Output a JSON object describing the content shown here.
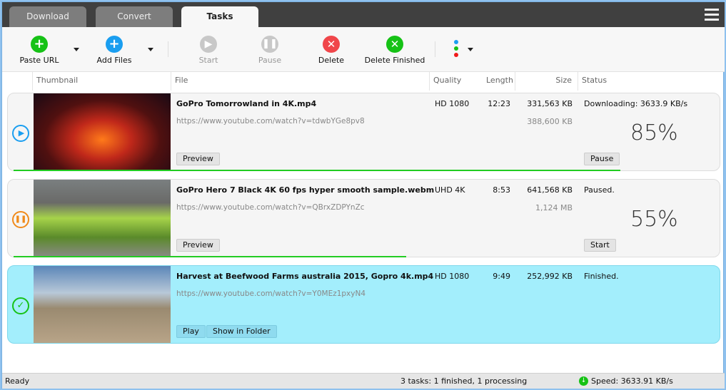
{
  "tabs": [
    {
      "label": "Download"
    },
    {
      "label": "Convert"
    },
    {
      "label": "Tasks",
      "active": true
    }
  ],
  "toolbar": {
    "paste_url": "Paste URL",
    "add_files": "Add Files",
    "start": "Start",
    "pause": "Pause",
    "delete": "Delete",
    "delete_finished": "Delete Finished"
  },
  "columns": {
    "thumbnail": "Thumbnail",
    "file": "File",
    "quality": "Quality",
    "length": "Length",
    "size": "Size",
    "status": "Status"
  },
  "tasks": [
    {
      "name": "GoPro  Tomorrowland in 4K.mp4",
      "url": "https://www.youtube.com/watch?v=tdwbYGe8pv8",
      "quality": "HD 1080",
      "length": "12:23",
      "size": "331,563 KB",
      "total": "388,600 KB",
      "status": "Downloading: 3633.9 KB/s",
      "percent": "85%",
      "progress": 0.85,
      "buttons": [
        "Preview"
      ],
      "action": "Pause",
      "state": "downloading"
    },
    {
      "name": "GoPro Hero 7 Black 4K 60 fps hyper smooth sample.webm",
      "url": "https://www.youtube.com/watch?v=QBrxZDPYnZc",
      "quality": "UHD 4K",
      "length": "8:53",
      "size": "641,568 KB",
      "total": "1,124 MB",
      "status": "Paused.",
      "percent": "55%",
      "progress": 0.55,
      "buttons": [
        "Preview"
      ],
      "action": "Start",
      "state": "paused"
    },
    {
      "name": "Harvest at Beefwood Farms australia 2015, Gopro 4k.mp4",
      "url": "https://www.youtube.com/watch?v=Y0MEz1pxyN4",
      "quality": "HD 1080",
      "length": "9:49",
      "size": "252,992 KB",
      "status": "Finished.",
      "buttons": [
        "Play",
        "Show in Folder"
      ],
      "state": "finished"
    }
  ],
  "statusbar": {
    "left": "Ready",
    "tasks": "3 tasks: 1 finished, 1 processing",
    "speed": "Speed: 3633.91 KB/s"
  },
  "colors": {
    "green": "#16c216",
    "blue": "#1a9ef0",
    "red": "#f0464a",
    "orange": "#f08a1a",
    "progress": "#22cc22",
    "finished_row": "#a3eefc"
  }
}
